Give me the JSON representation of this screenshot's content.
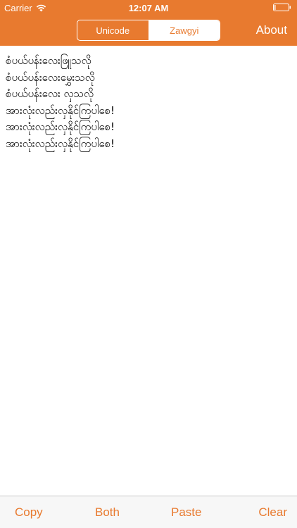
{
  "status_bar": {
    "carrier": "Carrier",
    "time": "12:07 AM",
    "icons": [
      "wifi-icon",
      "battery-icon"
    ]
  },
  "nav": {
    "segments": [
      {
        "label": "Unicode",
        "selected": false
      },
      {
        "label": "Zawgyi",
        "selected": true
      }
    ],
    "about_label": "About"
  },
  "content": {
    "lines": [
      "စံပယ်ပန်းလေးဖြူသလို",
      "စံပယ်ပန်းလေးမွှေးသလို",
      "စံပယ်ပန်းလေး လှသလို",
      "အားလုံးလည်းလှနိုင်ကြပါစေ!",
      "အားလုံးလည်းလှနိုင်ကြပါစေ!",
      "အားလုံးလည်းလှနိုင်ကြပါစေ!"
    ]
  },
  "toolbar": {
    "copy_label": "Copy",
    "both_label": "Both",
    "paste_label": "Paste",
    "clear_label": "Clear"
  },
  "colors": {
    "accent": "#e87a2f",
    "toolbar_bg": "#f7f7f7",
    "text": "#000000"
  }
}
